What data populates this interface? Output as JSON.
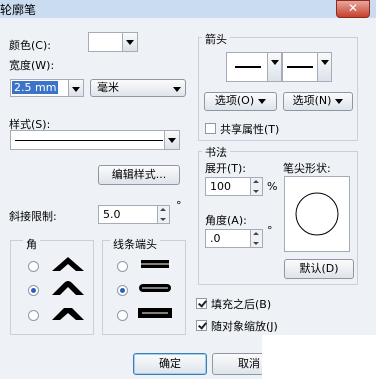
{
  "window": {
    "title": "轮廓笔",
    "close_glyph": "✕"
  },
  "color": {
    "label": "颜色(C):"
  },
  "width": {
    "label": "宽度(W):",
    "value": "2.5 mm",
    "unit": "毫米"
  },
  "style": {
    "label": "样式(S):",
    "edit_button": "编辑样式..."
  },
  "miter": {
    "label": "斜接限制:",
    "value": "5.0",
    "unit": "°"
  },
  "corners": {
    "label": "角",
    "options": [
      "miter-corner",
      "round-corner",
      "bevel-corner"
    ],
    "selected_index": 1
  },
  "line_caps": {
    "label": "线条端头",
    "options": [
      "butt-cap",
      "round-cap",
      "square-cap"
    ],
    "selected_index": 1
  },
  "arrows": {
    "label": "箭头",
    "options_left": "选项(O)",
    "options_right": "选项(N)",
    "share_attributes": "共享属性(T)",
    "share_checked": false
  },
  "calligraphy": {
    "label": "书法",
    "stretch_label": "展开(T):",
    "stretch_value": "100",
    "stretch_unit": "%",
    "angle_label": "角度(A):",
    "angle_value": ".0",
    "angle_unit": "°",
    "nib_label": "笔尖形状:",
    "default_button": "默认(D)"
  },
  "options": {
    "behind_fill": "填充之后(B)",
    "behind_fill_checked": true,
    "scale_with_image": "随对象缩放(J)",
    "scale_checked": true
  },
  "buttons": {
    "ok": "确定",
    "cancel": "取消"
  }
}
